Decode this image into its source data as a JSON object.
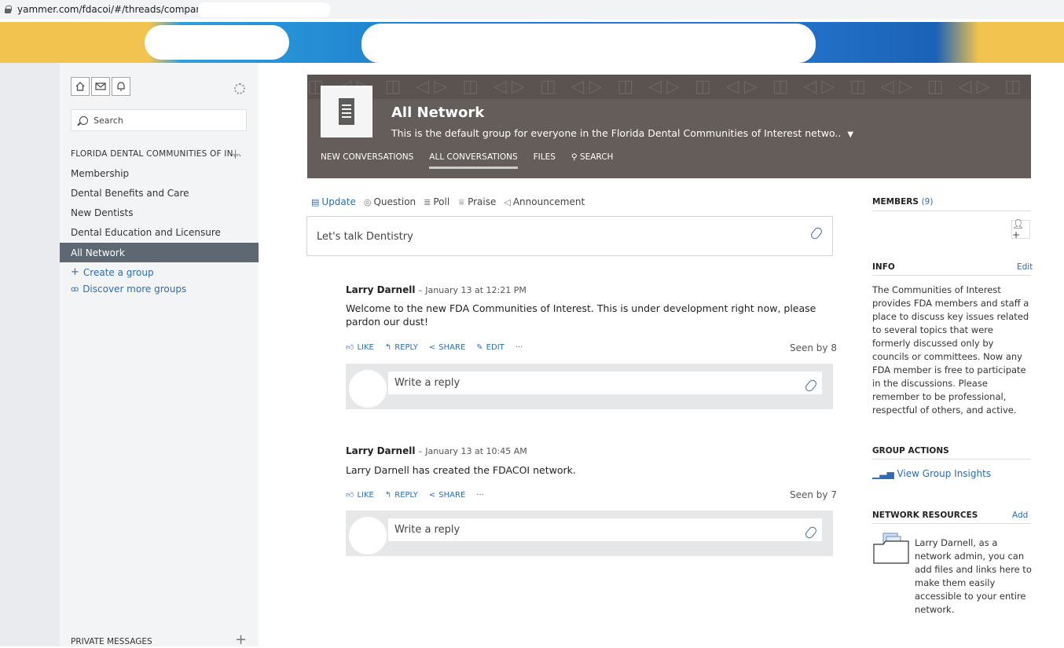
{
  "browser": {
    "url": "yammer.com/fdacoi/#/threads/company"
  },
  "sidebar": {
    "search_label": "Search",
    "section_title": "FLORIDA DENTAL COMMUNITIES OF IN...",
    "groups": [
      "Membership",
      "Dental Benefits and Care",
      "New Dentists",
      "Dental Education and Licensure",
      "All Network"
    ],
    "active_group": "All Network",
    "create_group": "Create a group",
    "discover_groups": "Discover more groups",
    "private_messages": "PRIVATE MESSAGES"
  },
  "group": {
    "name": "All Network",
    "description": "This is the default group for everyone in the Florida Dental Communities of Interest netwo..",
    "tabs": [
      "NEW CONVERSATIONS",
      "ALL CONVERSATIONS",
      "FILES",
      "SEARCH"
    ],
    "selected_tab": "ALL CONVERSATIONS"
  },
  "publisher": {
    "tabs": [
      "Update",
      "Question",
      "Poll",
      "Praise",
      "Announcement"
    ],
    "selected": "Update",
    "placeholder": "Let's talk Dentistry"
  },
  "posts": [
    {
      "author": "Larry Darnell",
      "date": "– January 13 at 12:21 PM",
      "body": "Welcome to the new FDA Communities of Interest. This is under development right now, please pardon our dust!",
      "actions": [
        "LIKE",
        "REPLY",
        "SHARE",
        "EDIT",
        "···"
      ],
      "seen": "Seen by 8",
      "reply_placeholder": "Write a reply"
    },
    {
      "author": "Larry Darnell",
      "date": "– January 13 at 10:45 AM",
      "body": "Larry Darnell has created the FDACOI network.",
      "actions": [
        "LIKE",
        "REPLY",
        "SHARE",
        "···"
      ],
      "seen": "Seen by 7",
      "reply_placeholder": "Write a reply"
    }
  ],
  "right_rail": {
    "members_title": "MEMBERS",
    "members_count": "(9)",
    "info_title": "INFO",
    "info_edit": "Edit",
    "info_text": "The Communities of Interest provides FDA members and staff a place to discuss key issues related to several topics that were formerly discussed only by councils or committees. Now any FDA member is free to participate in the discussions. Please remember to be professional, respectful of others, and active.",
    "group_actions_title": "GROUP ACTIONS",
    "view_insights": "View Group Insights",
    "resources_title": "NETWORK RESOURCES",
    "resources_add": "Add",
    "resources_text": "Larry Darnell, as a network admin, you can add files and links here to make them easily accessible to your entire network."
  },
  "colors": {
    "accent": "#2d6cb0",
    "header_bg": "#655d59",
    "active_item_bg": "#5e6873"
  }
}
